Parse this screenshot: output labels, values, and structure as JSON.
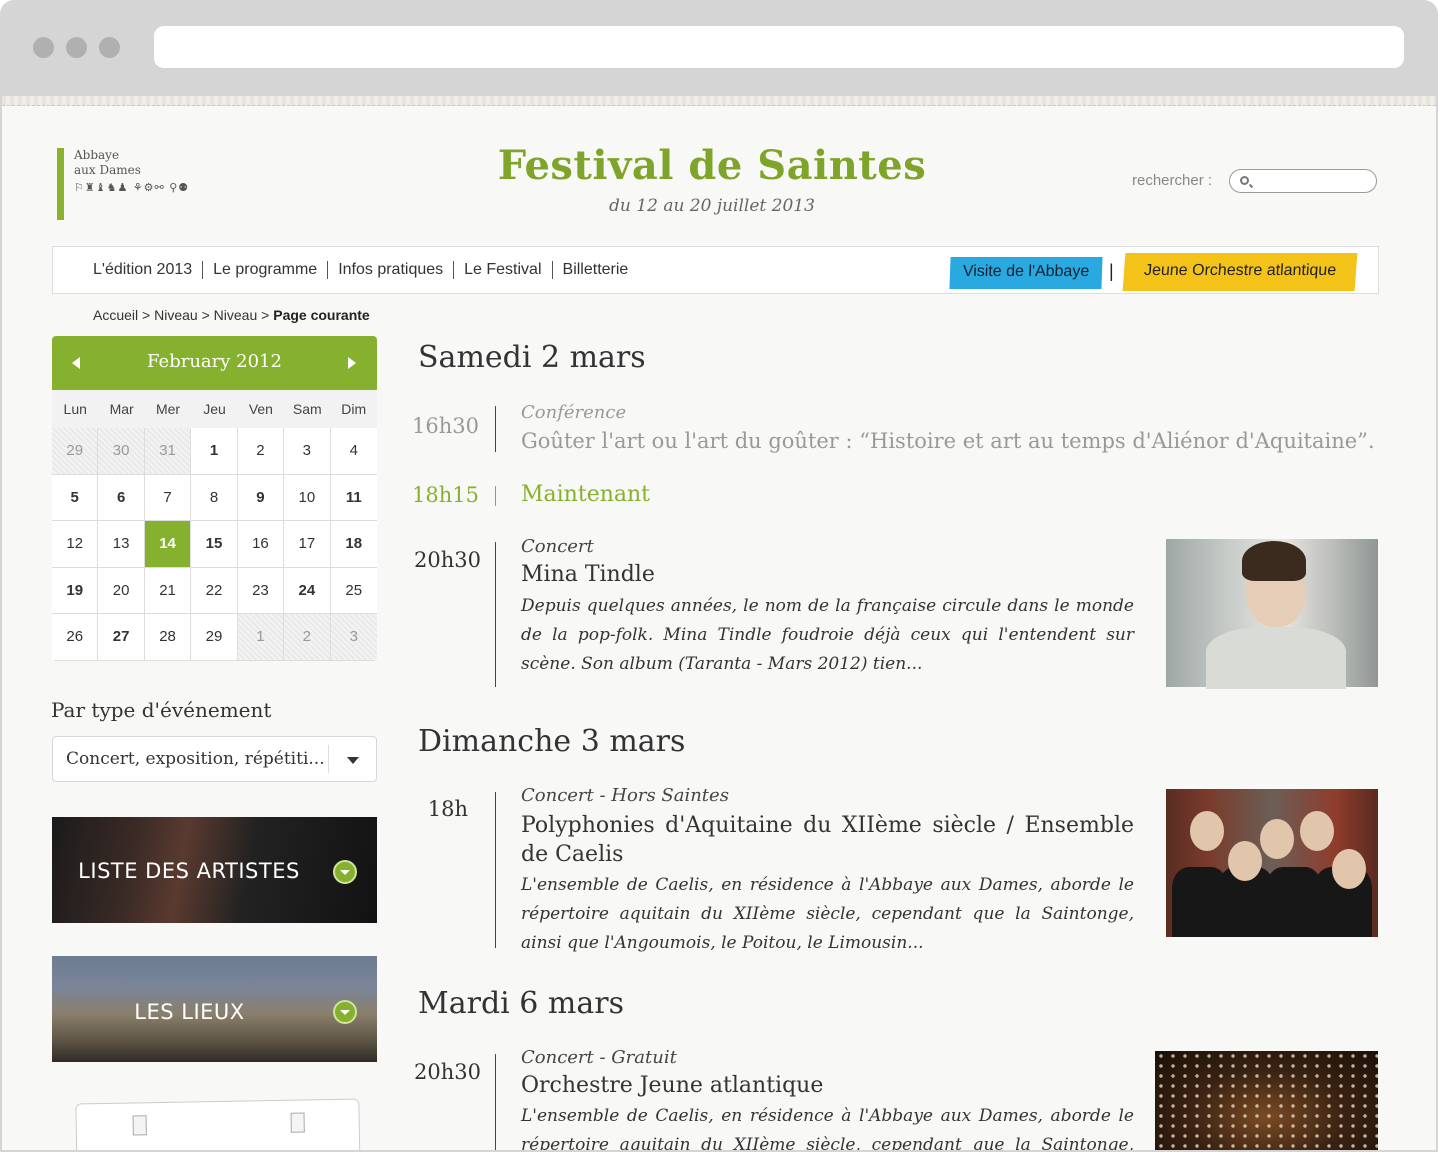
{
  "header": {
    "logo_line1": "Abbaye",
    "logo_line2": "aux Dames",
    "logo_glyphs": "⚐♜♝♞♟ ⚘⚙⚯ ⚲⚉",
    "title": "Festival de Saintes",
    "subtitle": "du 12 au 20 juillet 2013",
    "search_label": "rechercher :"
  },
  "nav": {
    "items": [
      "L'édition 2013",
      "Le programme",
      "Infos pratiques",
      "Le Festival",
      "Billetterie"
    ],
    "blue_button": "Visite de l'Abbaye",
    "separator": "|",
    "yellow_button": "Jeune Orchestre atlantique",
    "colors": {
      "accent_green": "#86b12f",
      "blue": "#2aa8e0",
      "yellow": "#f4c31a"
    }
  },
  "breadcrumb": {
    "items": [
      "Accueil",
      "Niveau",
      "Niveau"
    ],
    "separator": ">",
    "current": "Page courante"
  },
  "calendar": {
    "month": "February 2012",
    "weekdays": [
      "Lun",
      "Mar",
      "Mer",
      "Jeu",
      "Ven",
      "Sam",
      "Dim"
    ],
    "days": [
      {
        "d": "29",
        "s": "muted"
      },
      {
        "d": "30",
        "s": "muted"
      },
      {
        "d": "31",
        "s": "muted"
      },
      {
        "d": "1",
        "s": "bold"
      },
      {
        "d": "2",
        "s": ""
      },
      {
        "d": "3",
        "s": ""
      },
      {
        "d": "4",
        "s": ""
      },
      {
        "d": "5",
        "s": "bold"
      },
      {
        "d": "6",
        "s": "bold"
      },
      {
        "d": "7",
        "s": ""
      },
      {
        "d": "8",
        "s": ""
      },
      {
        "d": "9",
        "s": "bold"
      },
      {
        "d": "10",
        "s": ""
      },
      {
        "d": "11",
        "s": "bold"
      },
      {
        "d": "12",
        "s": ""
      },
      {
        "d": "13",
        "s": ""
      },
      {
        "d": "14",
        "s": "today"
      },
      {
        "d": "15",
        "s": "bold"
      },
      {
        "d": "16",
        "s": ""
      },
      {
        "d": "17",
        "s": ""
      },
      {
        "d": "18",
        "s": "bold"
      },
      {
        "d": "19",
        "s": "bold"
      },
      {
        "d": "20",
        "s": ""
      },
      {
        "d": "21",
        "s": ""
      },
      {
        "d": "22",
        "s": ""
      },
      {
        "d": "23",
        "s": ""
      },
      {
        "d": "24",
        "s": "bold"
      },
      {
        "d": "25",
        "s": ""
      },
      {
        "d": "26",
        "s": ""
      },
      {
        "d": "27",
        "s": "bold"
      },
      {
        "d": "28",
        "s": ""
      },
      {
        "d": "29",
        "s": ""
      },
      {
        "d": "1",
        "s": "muted"
      },
      {
        "d": "2",
        "s": "muted"
      },
      {
        "d": "3",
        "s": "muted"
      }
    ]
  },
  "filter": {
    "title": "Par type d'événement",
    "value": "Concert, exposition, répétiti..."
  },
  "tiles": {
    "artists": "LISTE DES ARTISTES",
    "places": "LES LIEUX"
  },
  "program": {
    "day1": {
      "heading": "Samedi 2 mars",
      "e1_time": "16h30",
      "e1_cat": "Conférence",
      "e1_title": "Goûter l'art ou l'art du goûter : “Histoire et art au temps d'Aliénor d'Aquitaine”.",
      "e2_time": "18h15",
      "e2_title": "Maintenant",
      "e3_time": "20h30",
      "e3_cat": "Concert",
      "e3_title": "Mina Tindle",
      "e3_desc": "Depuis quelques années, le nom de la française circule dans le monde de la pop-folk. Mina Tindle foudroie déjà ceux qui l'entendent sur scène. Son album (Taranta - Mars 2012) tien..."
    },
    "day2": {
      "heading": "Dimanche 3 mars",
      "e1_time": "18h",
      "e1_cat": "Concert - Hors Saintes",
      "e1_title": "Polyphonies d'Aquitaine du XIIème siècle / Ensemble de Caelis",
      "e1_desc": "L'ensemble de Caelis, en résidence à l'Abbaye aux Dames, aborde le répertoire aquitain du XIIème siècle, cependant que la Saintonge, ainsi que l'Angoumois, le Poitou, le Limousin..."
    },
    "day3": {
      "heading": "Mardi 6 mars",
      "e1_time": "20h30",
      "e1_cat": "Concert - Gratuit",
      "e1_title": "Orchestre Jeune atlantique",
      "e1_desc": "L'ensemble de Caelis, en résidence à l'Abbaye aux Dames, aborde le répertoire aquitain du XIIème siècle, cependant que la Saintonge, ainsi que l'Angoumois,"
    }
  }
}
